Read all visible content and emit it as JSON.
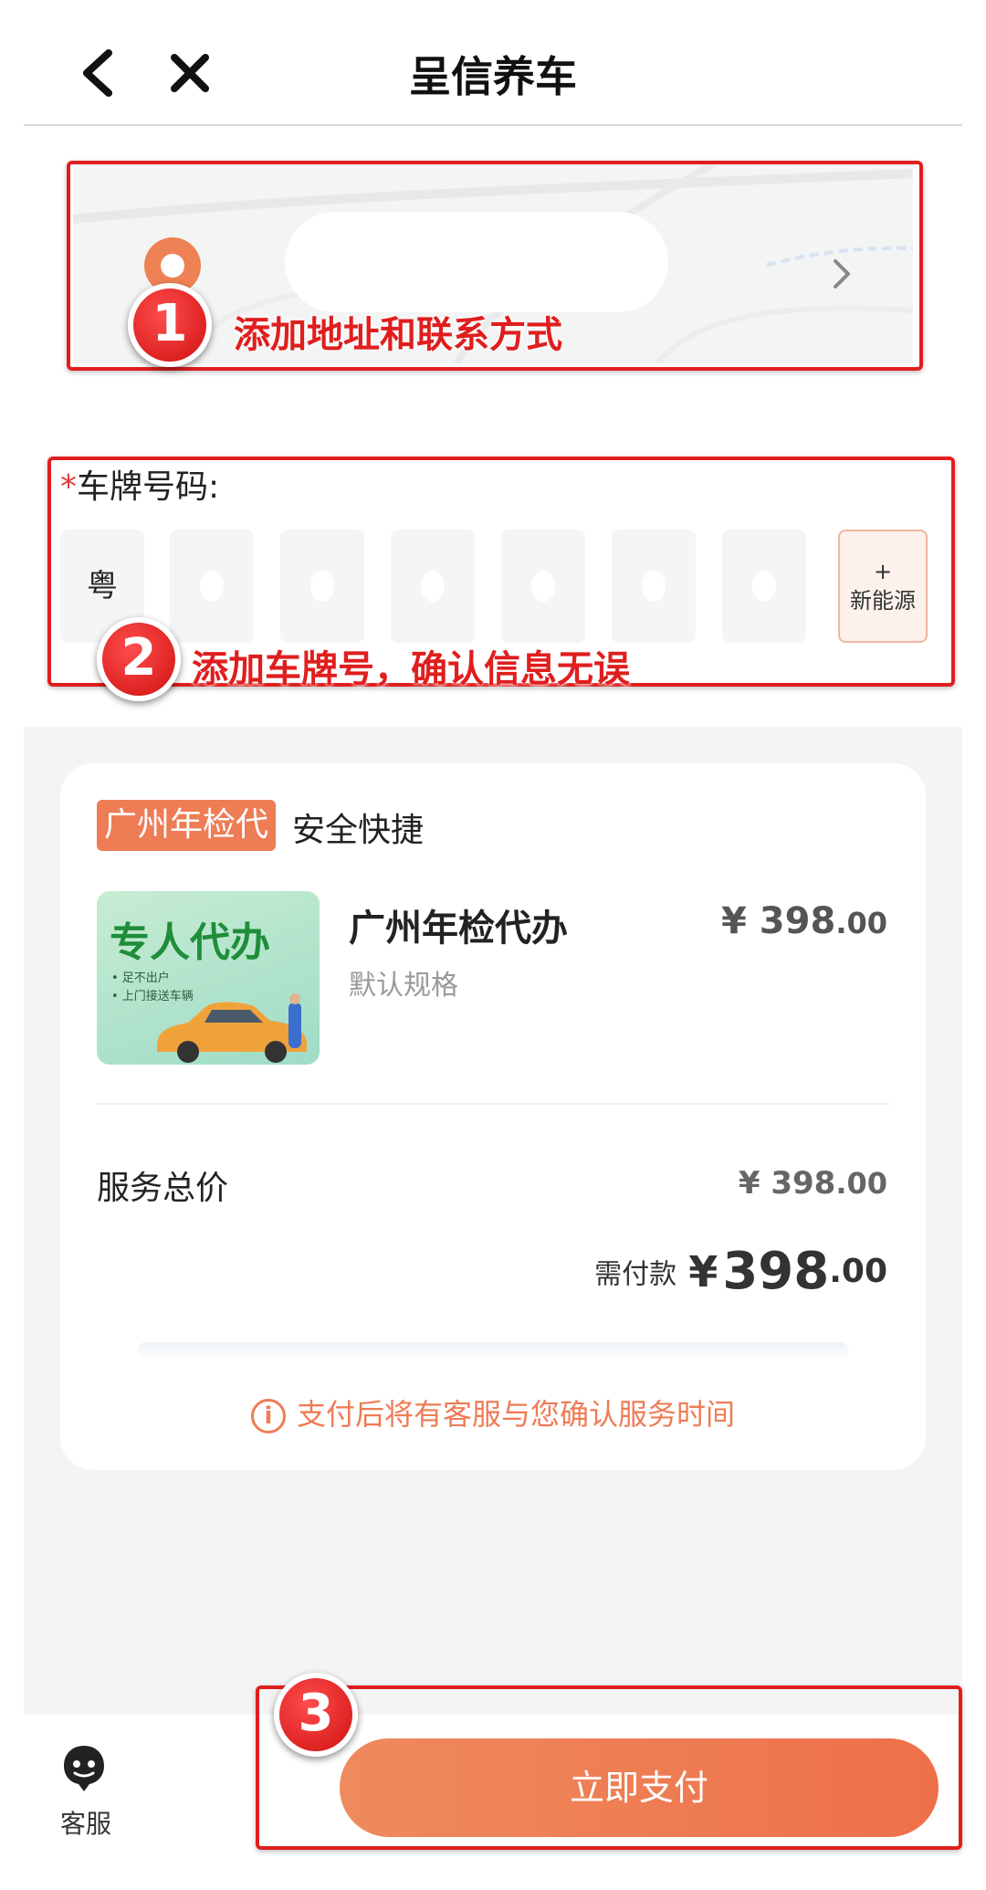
{
  "header": {
    "title": "呈信养车"
  },
  "annotations": {
    "step1": {
      "number": "1",
      "text": "添加地址和联系方式"
    },
    "step2": {
      "number": "2",
      "text": "添加车牌号，确认信息无误"
    },
    "step3": {
      "number": "3"
    }
  },
  "plate": {
    "required_mark": "*",
    "label": "车牌号码:",
    "province": "粤",
    "new_energy_plus": "+",
    "new_energy_label": "新能源"
  },
  "order": {
    "tag": "广州年检代",
    "tagline": "安全快捷",
    "image_text": {
      "headline": "专人代办",
      "bullet1": "• 足不出户",
      "bullet2": "• 上门接送车辆"
    },
    "product_name": "广州年检代办",
    "product_spec": "默认规格",
    "product_price_main": "¥ 398",
    "product_price_dec": ".00",
    "total_label": "服务总价",
    "total_price_main": "¥ 398",
    "total_price_dec": ".00",
    "payable_label": "需付款",
    "payable_symbol": "¥",
    "payable_int": "398",
    "payable_dec": ".00",
    "notice": "支付后将有客服与您确认服务时间"
  },
  "bottom": {
    "service_label": "客服",
    "pay_button": "立即支付"
  },
  "colors": {
    "accent": "#ee7c55",
    "annotation_red": "#e01e1e"
  }
}
